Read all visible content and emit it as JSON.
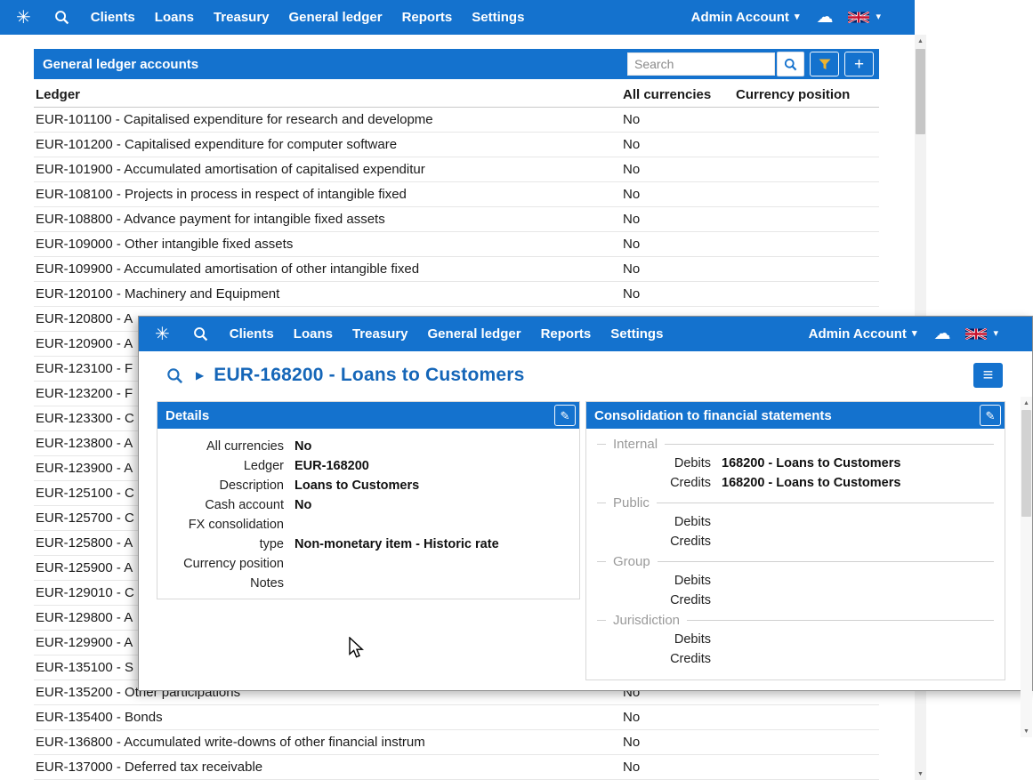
{
  "colors": {
    "navbar_blue": "#1472ce",
    "title_blue": "#1566b8",
    "funnel_gold": "#f0b32e"
  },
  "icons": {
    "logo": "✳",
    "cloud": "☁",
    "caret": "▾",
    "chevron_right": "▶",
    "pencil": "✎",
    "hamburger": "≡",
    "plus": "+"
  },
  "navbar": {
    "items": [
      "Clients",
      "Loans",
      "Treasury",
      "General ledger",
      "Reports",
      "Settings"
    ],
    "account_label": "Admin Account"
  },
  "ledger_page": {
    "title": "General ledger accounts",
    "search_placeholder": "Search",
    "table": {
      "columns": [
        "Ledger",
        "All currencies",
        "Currency position"
      ],
      "rows": [
        {
          "ledger": "EUR-101100 - Capitalised expenditure for research and developme",
          "all_currencies": "No",
          "currency_position": ""
        },
        {
          "ledger": "EUR-101200 - Capitalised expenditure for computer software",
          "all_currencies": "No",
          "currency_position": ""
        },
        {
          "ledger": "EUR-101900 - Accumulated amortisation of capitalised expenditur",
          "all_currencies": "No",
          "currency_position": ""
        },
        {
          "ledger": "EUR-108100 - Projects in process in respect of intangible fixed",
          "all_currencies": "No",
          "currency_position": ""
        },
        {
          "ledger": "EUR-108800 - Advance payment for intangible fixed assets",
          "all_currencies": "No",
          "currency_position": ""
        },
        {
          "ledger": "EUR-109000 - Other intangible fixed assets",
          "all_currencies": "No",
          "currency_position": ""
        },
        {
          "ledger": "EUR-109900 - Accumulated amortisation of other intangible fixed",
          "all_currencies": "No",
          "currency_position": ""
        },
        {
          "ledger": "EUR-120100 - Machinery and Equipment",
          "all_currencies": "No",
          "currency_position": ""
        },
        {
          "ledger": "EUR-120800 - A",
          "all_currencies": "",
          "currency_position": ""
        },
        {
          "ledger": "EUR-120900 - A",
          "all_currencies": "",
          "currency_position": ""
        },
        {
          "ledger": "EUR-123100 - F",
          "all_currencies": "",
          "currency_position": ""
        },
        {
          "ledger": "EUR-123200 - F",
          "all_currencies": "",
          "currency_position": ""
        },
        {
          "ledger": "EUR-123300 - C",
          "all_currencies": "",
          "currency_position": ""
        },
        {
          "ledger": "EUR-123800 - A",
          "all_currencies": "",
          "currency_position": ""
        },
        {
          "ledger": "EUR-123900 - A",
          "all_currencies": "",
          "currency_position": ""
        },
        {
          "ledger": "EUR-125100 - C",
          "all_currencies": "",
          "currency_position": ""
        },
        {
          "ledger": "EUR-125700 - C",
          "all_currencies": "",
          "currency_position": ""
        },
        {
          "ledger": "EUR-125800 - A",
          "all_currencies": "",
          "currency_position": ""
        },
        {
          "ledger": "EUR-125900 - A",
          "all_currencies": "",
          "currency_position": ""
        },
        {
          "ledger": "EUR-129010 - C",
          "all_currencies": "",
          "currency_position": ""
        },
        {
          "ledger": "EUR-129800 - A",
          "all_currencies": "",
          "currency_position": ""
        },
        {
          "ledger": "EUR-129900 - A",
          "all_currencies": "",
          "currency_position": ""
        },
        {
          "ledger": "EUR-135100 - S",
          "all_currencies": "",
          "currency_position": ""
        },
        {
          "ledger": "EUR-135200 - Other participations",
          "all_currencies": "No",
          "currency_position": ""
        },
        {
          "ledger": "EUR-135400 - Bonds",
          "all_currencies": "No",
          "currency_position": ""
        },
        {
          "ledger": "EUR-136800 - Accumulated write-downs of other financial instrum",
          "all_currencies": "No",
          "currency_position": ""
        },
        {
          "ledger": "EUR-137000 - Deferred tax receivable",
          "all_currencies": "No",
          "currency_position": ""
        }
      ]
    }
  },
  "detail_page": {
    "title": "EUR-168200 - Loans to Customers",
    "details_panel": {
      "title": "Details",
      "fields": [
        {
          "label": "All currencies",
          "value": "No"
        },
        {
          "label": "Ledger",
          "value": "EUR-168200"
        },
        {
          "label": "Description",
          "value": "Loans to Customers"
        },
        {
          "label": "Cash account",
          "value": "No"
        },
        {
          "label": "FX consolidation type",
          "value": "Non-monetary item - Historic rate"
        },
        {
          "label": "Currency position",
          "value": ""
        },
        {
          "label": "Notes",
          "value": ""
        }
      ]
    },
    "consolidation_panel": {
      "title": "Consolidation to financial statements",
      "row_labels": {
        "debits": "Debits",
        "credits": "Credits"
      },
      "groups": [
        {
          "legend": "Internal",
          "debits": "168200 - Loans to Customers",
          "credits": "168200 - Loans to Customers"
        },
        {
          "legend": "Public",
          "debits": "",
          "credits": ""
        },
        {
          "legend": "Group",
          "debits": "",
          "credits": ""
        },
        {
          "legend": "Jurisdiction",
          "debits": "",
          "credits": ""
        }
      ]
    }
  }
}
